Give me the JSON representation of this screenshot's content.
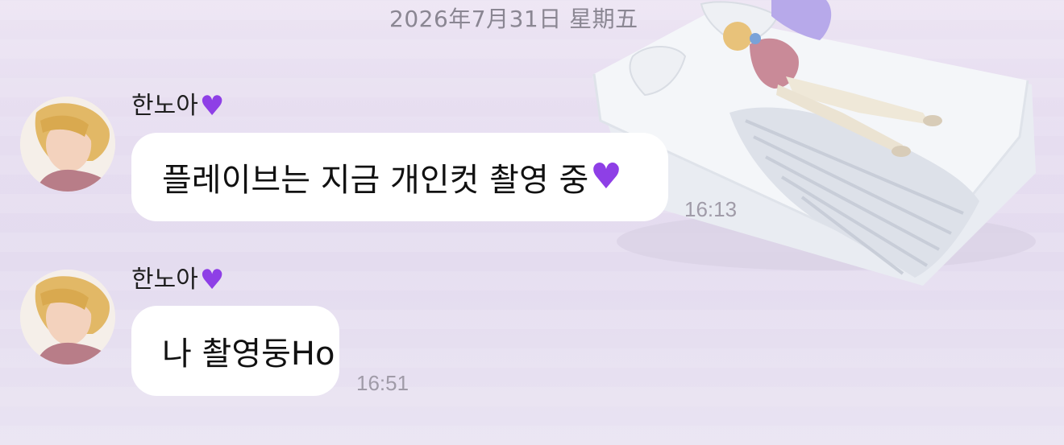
{
  "chat": {
    "date_header": "2026年7月31日 星期五",
    "messages": [
      {
        "sender": "한노아",
        "sender_emoji": "💜",
        "text": "플레이브는 지금 개인컷 촬영 중",
        "text_emoji": "💜",
        "time": "16:13"
      },
      {
        "sender": "한노아",
        "sender_emoji": "💜",
        "text": "나 촬영둥Ho",
        "text_emoji": "",
        "time": "16:51"
      }
    ]
  },
  "colors": {
    "background": "#e6ddf0",
    "bubble": "#ffffff",
    "heart": "#8e3fe6",
    "timestamp": "#a09ba8",
    "date_header": "#8a8692"
  },
  "icons": {
    "heart": "purple-heart-icon"
  }
}
